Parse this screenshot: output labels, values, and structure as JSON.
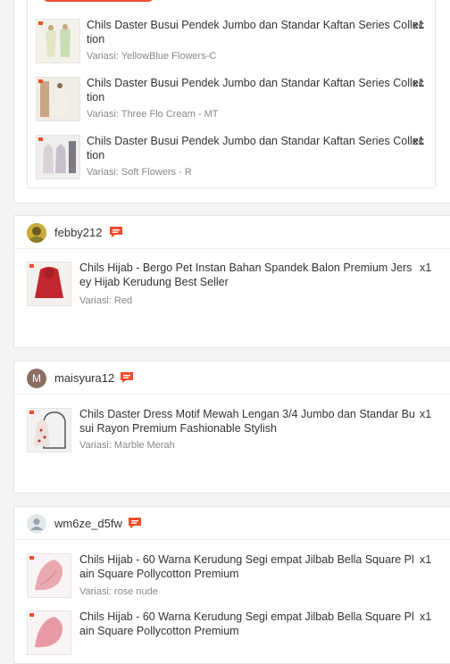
{
  "orders": [
    {
      "items": [
        {
          "title": "Chils Daster Busui Pendek Jumbo dan Standar Kaftan Series Collection",
          "variation": "Variasi: YellowBlue Flowers-C",
          "qty": "x1"
        },
        {
          "title": "Chils Daster Busui Pendek Jumbo dan Standar Kaftan Series Collection",
          "variation": "Variasi: Three Flo Cream - MT",
          "qty": "x1"
        },
        {
          "title": "Chils Daster Busui Pendek Jumbo dan Standar Kaftan Series Collection",
          "variation": "Variasi: Soft Flowers - R",
          "qty": "x1"
        }
      ]
    },
    {
      "username": "febby212",
      "items": [
        {
          "title": "Chils Hijab - Bergo Pet Instan Bahan Spandek Balon Premium Jersey Hijab Kerudung Best Seller",
          "variation": "Variasi: Red",
          "qty": "x1"
        }
      ]
    },
    {
      "username": "maisyura12",
      "avatar_letter": "M",
      "items": [
        {
          "title": "Chils Daster Dress Motif Mewah Lengan 3/4 Jumbo dan Standar Busui Rayon Premium Fashionable Stylish",
          "variation": "Variasi: Marble Merah",
          "qty": "x1"
        }
      ]
    },
    {
      "username": "wm6ze_d5fw",
      "items": [
        {
          "title": "Chils Hijab - 60 Warna Kerudung Segi empat Jilbab Bella Square Plain Square Pollycotton Premium",
          "variation": "Variasi: rose nude",
          "qty": "x1"
        },
        {
          "title": "Chils Hijab - 60 Warna Kerudung Segi empat Jilbab Bella Square Plain Square Pollycotton Premium",
          "qty": "x1"
        }
      ]
    }
  ],
  "colors": {
    "accent": "#ee4d2d",
    "text": "#333333",
    "muted": "#888888"
  },
  "icons": {
    "chat": "chat-icon",
    "user": "user-icon"
  }
}
